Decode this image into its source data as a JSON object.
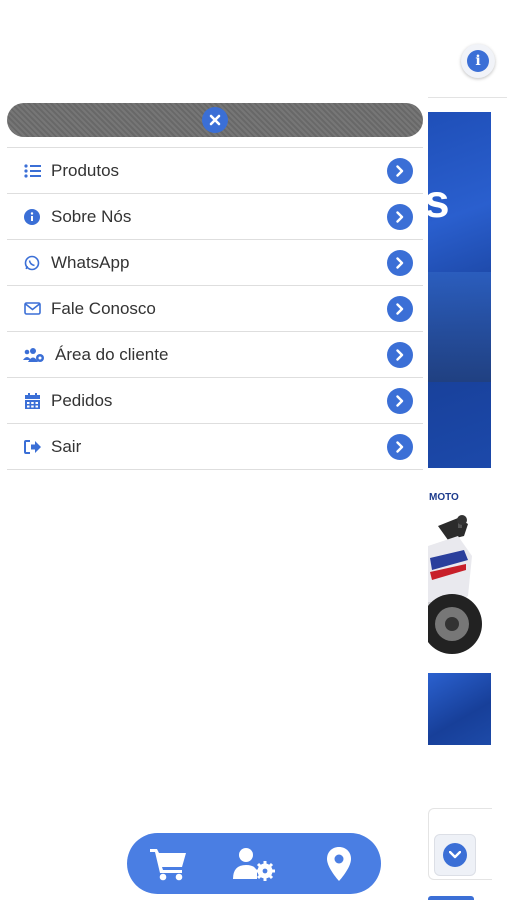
{
  "menu": {
    "items": [
      {
        "label": "Produtos",
        "icon": "list-icon"
      },
      {
        "label": "Sobre Nós",
        "icon": "info-icon"
      },
      {
        "label": "WhatsApp",
        "icon": "whatsapp-icon"
      },
      {
        "label": "Fale Conosco",
        "icon": "envelope-icon"
      },
      {
        "label": "Área do cliente",
        "icon": "users-cog-icon"
      },
      {
        "label": "Pedidos",
        "icon": "calendar-icon"
      },
      {
        "label": "Sair",
        "icon": "sign-out-icon"
      }
    ]
  },
  "background": {
    "banner_letter": "s",
    "moto_label": "MOTO"
  },
  "bottom_bar": {
    "icons": [
      "cart-icon",
      "user-cog-icon",
      "map-marker-icon"
    ]
  },
  "colors": {
    "accent": "#3b6fd6",
    "bottom_bar": "#4a7ee3",
    "close_bar": "#6e6e6e"
  }
}
